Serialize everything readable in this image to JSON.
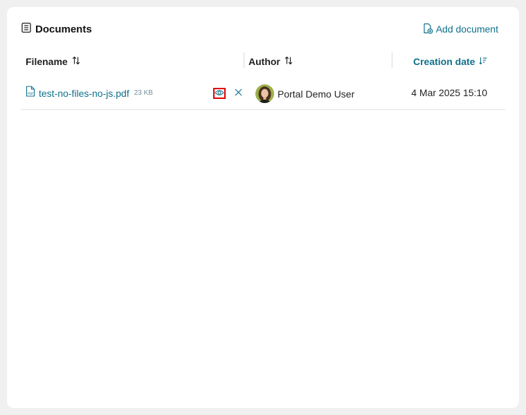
{
  "panel": {
    "title": "Documents",
    "add_document_label": "Add document"
  },
  "table": {
    "columns": [
      {
        "label": "Filename",
        "sort": "none"
      },
      {
        "label": "Author",
        "sort": "none"
      },
      {
        "label": "Creation date",
        "sort": "descending"
      }
    ],
    "rows": [
      {
        "filename": "test-no-files-no-js.pdf",
        "size": "23 KB",
        "author": "Portal Demo User",
        "created": "4 Mar 2025 15:10"
      }
    ]
  },
  "colors": {
    "accent": "#0e6f8a",
    "highlight_border": "#e00000"
  },
  "icons": {
    "title": "document-list-icon",
    "add": "add-document-icon",
    "file": "pdf-file-icon",
    "view": "eye-icon",
    "remove": "close-icon",
    "sort": "sort-arrows-icon",
    "sort_active": "sort-descending-icon"
  }
}
